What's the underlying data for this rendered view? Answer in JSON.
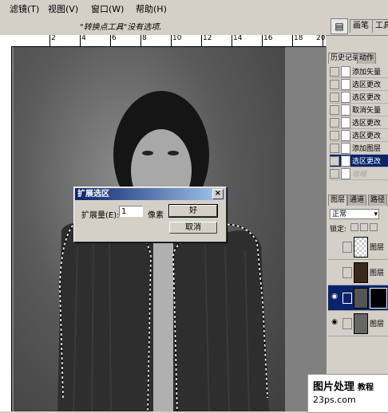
{
  "menu": [
    "滤镜(T)",
    "视图(V)",
    "窗口(W)",
    "帮助(H)"
  ],
  "options_bar": {
    "hint": "\"转换点工具\"没有选项.",
    "well_tabs": [
      "画笔",
      "工具"
    ]
  },
  "ruler": {
    "top_labels": [
      "2",
      "4",
      "6",
      "8",
      "10",
      "12",
      "14",
      "16",
      "18",
      "20"
    ]
  },
  "dialog": {
    "title": "扩展选区",
    "label": "扩展量(E):",
    "value": "1",
    "unit": "像素",
    "ok": "好",
    "cancel": "取消",
    "close": "×"
  },
  "history": {
    "tabs": [
      "历史记录",
      "动作"
    ],
    "items": [
      "添加矢量",
      "选区更改",
      "选区更改",
      "取消矢量",
      "选区更改",
      "选区更改",
      "添加图层",
      "选区更改",
      "收缩"
    ],
    "selected_index": 7
  },
  "layers": {
    "tabs": [
      "图层",
      "通道",
      "路径"
    ],
    "blend_mode": "正常",
    "lock_label": "锁定:",
    "items": [
      "图层",
      "图层",
      "",
      "图层"
    ],
    "selected_index": 2
  },
  "watermark": {
    "line1": "图片处理",
    "line1b": "教程",
    "line2": "23ps.com"
  }
}
